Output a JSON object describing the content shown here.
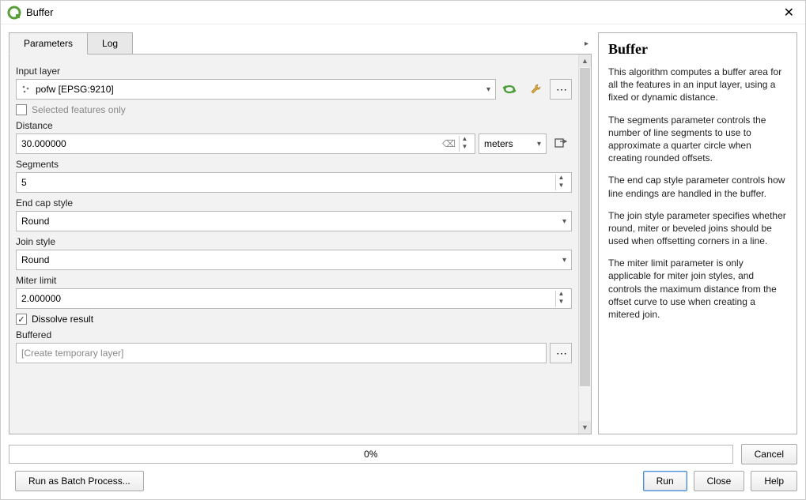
{
  "window": {
    "title": "Buffer"
  },
  "tabs": {
    "parameters": "Parameters",
    "log": "Log"
  },
  "labels": {
    "input_layer": "Input layer",
    "selected_only": "Selected features only",
    "distance": "Distance",
    "segments": "Segments",
    "end_cap": "End cap style",
    "join_style": "Join style",
    "miter_limit": "Miter limit",
    "dissolve": "Dissolve result",
    "buffered": "Buffered"
  },
  "values": {
    "input_layer": "pofw [EPSG:9210]",
    "selected_only_checked": false,
    "distance": "30.000000",
    "distance_unit": "meters",
    "segments": "5",
    "end_cap": "Round",
    "join_style": "Round",
    "miter_limit": "2.000000",
    "dissolve_checked": true,
    "buffered_placeholder": "[Create temporary layer]"
  },
  "progress": {
    "text": "0%"
  },
  "buttons": {
    "cancel": "Cancel",
    "batch": "Run as Batch Process...",
    "run": "Run",
    "close": "Close",
    "help": "Help"
  },
  "help": {
    "title": "Buffer",
    "p1": "This algorithm computes a buffer area for all the features in an input layer, using a fixed or dynamic distance.",
    "p2": "The segments parameter controls the number of line segments to use to approximate a quarter circle when creating rounded offsets.",
    "p3": "The end cap style parameter controls how line endings are handled in the buffer.",
    "p4": "The join style parameter specifies whether round, miter or beveled joins should be used when offsetting corners in a line.",
    "p5": "The miter limit parameter is only applicable for miter join styles, and controls the maximum distance from the offset curve to use when creating a mitered join."
  }
}
